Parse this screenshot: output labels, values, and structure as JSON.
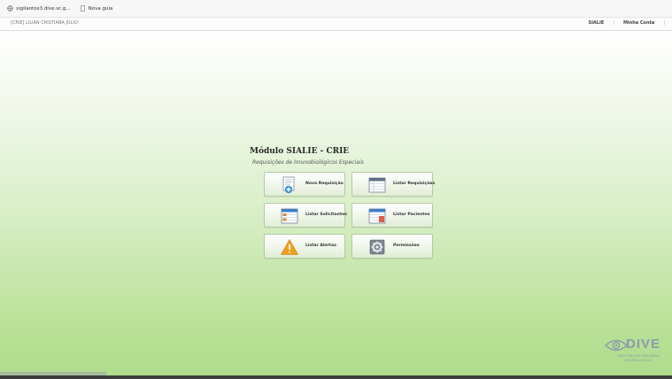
{
  "bookmarks": [
    {
      "label": "vigilantos3.dive.sc.g...",
      "icon": "bookmark-globe-icon"
    },
    {
      "label": "Nova guia",
      "icon": "new-tab-page-icon"
    }
  ],
  "topbar": {
    "user": "[CRIE] LILIAN CRISTIANA JULIO",
    "nav": [
      "SIALIE",
      "|",
      "Minha Conta",
      "|"
    ]
  },
  "module": {
    "title": "Módulo SIALIE - CRIE",
    "subtitle": "Requisições de Imunobiológicos Especiais"
  },
  "buttons": [
    {
      "label": "Nova Requisição",
      "icon": "new-request-doc-plus-icon"
    },
    {
      "label": "Listar Requisições",
      "icon": "list-requests-table-icon"
    },
    {
      "label": "Listar Solicitantes",
      "icon": "list-requesters-table-icon"
    },
    {
      "label": "Listar Pacientes",
      "icon": "list-patients-table-icon"
    },
    {
      "label": "Listar Alertas",
      "icon": "warning-triangle-icon"
    },
    {
      "label": "Permissões",
      "icon": "permissions-gear-icon"
    }
  ],
  "logo": {
    "word": "DIVE",
    "subtitle_line1": "DIRETORIA DE VIGILÂNCIA",
    "subtitle_line2": "EPIDEMIOLÓGICA"
  },
  "colors": {
    "gradient_top": "#ffffff",
    "gradient_bottom": "#b0dc8c",
    "button_border": "#b5c9a6",
    "logo": "#8d99ad"
  }
}
